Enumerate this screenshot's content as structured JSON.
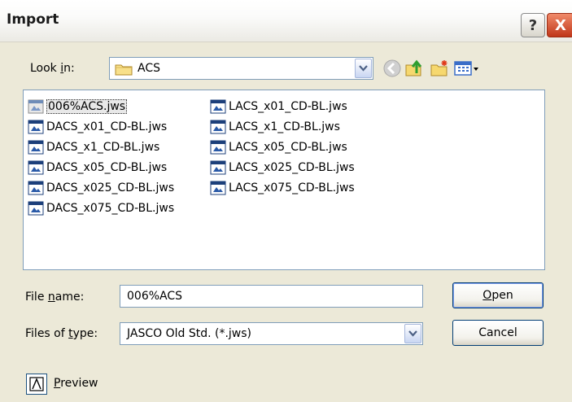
{
  "dialog": {
    "title": "Import",
    "help_glyph": "?",
    "close_glyph": "X"
  },
  "look_in": {
    "label_pre": "Look ",
    "label_key": "i",
    "label_post": "n:",
    "value": "ACS",
    "icon": "folder-icon"
  },
  "toolbar": {
    "icons": [
      "back-icon",
      "up-folder-icon",
      "new-folder-icon",
      "view-menu-icon"
    ]
  },
  "files": {
    "column1": [
      {
        "name": "006%ACS.jws",
        "selected": true
      },
      {
        "name": "DACS_x01_CD-BL.jws"
      },
      {
        "name": "DACS_x1_CD-BL.jws"
      },
      {
        "name": "DACS_x05_CD-BL.jws"
      },
      {
        "name": "DACS_x025_CD-BL.jws"
      },
      {
        "name": "DACS_x075_CD-BL.jws"
      }
    ],
    "column2": [
      {
        "name": "LACS_x01_CD-BL.jws"
      },
      {
        "name": "LACS_x1_CD-BL.jws"
      },
      {
        "name": "LACS_x05_CD-BL.jws"
      },
      {
        "name": "LACS_x025_CD-BL.jws"
      },
      {
        "name": "LACS_x075_CD-BL.jws"
      }
    ]
  },
  "file_name": {
    "label_pre": "File ",
    "label_key": "n",
    "label_post": "ame:",
    "value": "006%ACS"
  },
  "file_type": {
    "label_pre": "Files of ",
    "label_key": "t",
    "label_post": "ype:",
    "value": "JASCO Old Std. (*.jws)"
  },
  "buttons": {
    "open_key": "O",
    "open_rest": "pen",
    "cancel": "Cancel"
  },
  "preview": {
    "key": "P",
    "rest": "review"
  },
  "colors": {
    "dialog_bg": "#ece9d8",
    "field_border": "#7f9db9",
    "button_border": "#003c74"
  }
}
